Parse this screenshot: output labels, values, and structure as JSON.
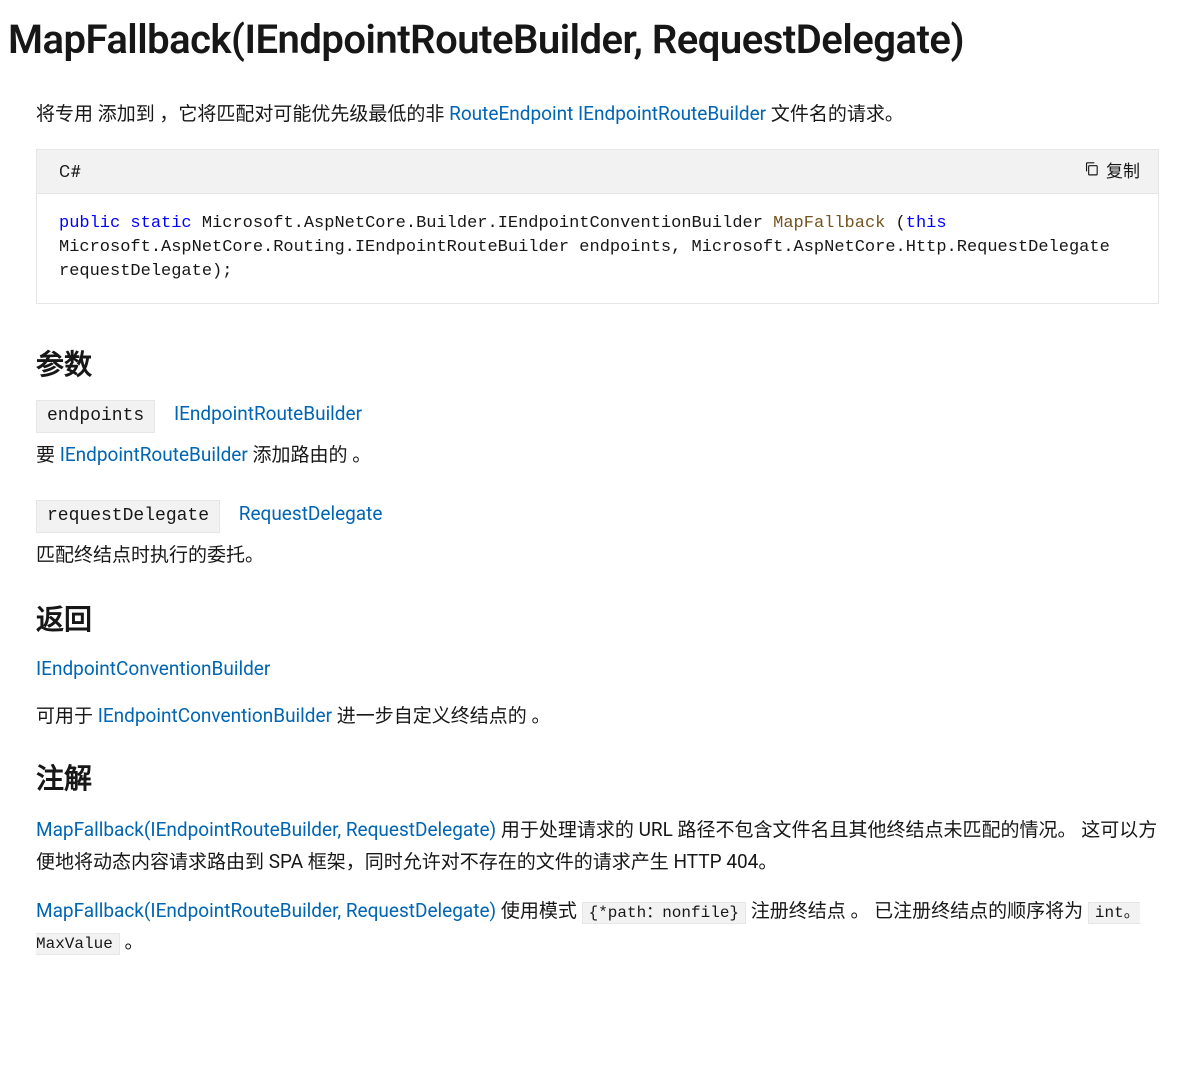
{
  "title": "MapFallback(IEndpointRouteBuilder, RequestDelegate)",
  "intro": {
    "prefix": "将专用 添加到 ，它将匹配对可能优先级最低的非 ",
    "link1": "RouteEndpoint",
    "link2": "IEndpointRouteBuilder",
    "suffix": " 文件名的请求。"
  },
  "code": {
    "lang": "C#",
    "copyLabel": "复制",
    "kw_public": "public",
    "kw_static": "static",
    "seg1": " Microsoft.AspNetCore.Builder.IEndpointConventionBuilder ",
    "method": "MapFallback",
    "seg2": " (",
    "kw_this": "this",
    "seg3": " Microsoft.AspNetCore.Routing.IEndpointRouteBuilder endpoints, Microsoft.AspNetCore.Http.RequestDelegate requestDelegate);"
  },
  "sections": {
    "params": "参数",
    "returns": "返回",
    "remarks": "注解"
  },
  "params": {
    "p1": {
      "name": "endpoints",
      "type": "IEndpointRouteBuilder",
      "desc_prefix": "要 ",
      "desc_link": "IEndpointRouteBuilder",
      "desc_suffix": " 添加路由的 。"
    },
    "p2": {
      "name": "requestDelegate",
      "type": "RequestDelegate",
      "desc": "匹配终结点时执行的委托。"
    }
  },
  "returns": {
    "link": "IEndpointConventionBuilder",
    "desc_prefix": "可用于 ",
    "desc_link": "IEndpointConventionBuilder",
    "desc_suffix": " 进一步自定义终结点的 。"
  },
  "remarks": {
    "p1": {
      "link": "MapFallback(IEndpointRouteBuilder, RequestDelegate)",
      "text": " 用于处理请求的 URL 路径不包含文件名且其他终结点未匹配的情况。 这可以方便地将动态内容请求路由到 SPA 框架，同时允许对不存在的文件的请求产生 HTTP 404。"
    },
    "p2": {
      "link": "MapFallback(IEndpointRouteBuilder, RequestDelegate)",
      "text1": " 使用模式 ",
      "code1": "{*path：nonfile}",
      "text2": " 注册终结点 。 已注册终结点的顺序将为 ",
      "code2": "int。MaxValue",
      "text3": " 。"
    }
  }
}
